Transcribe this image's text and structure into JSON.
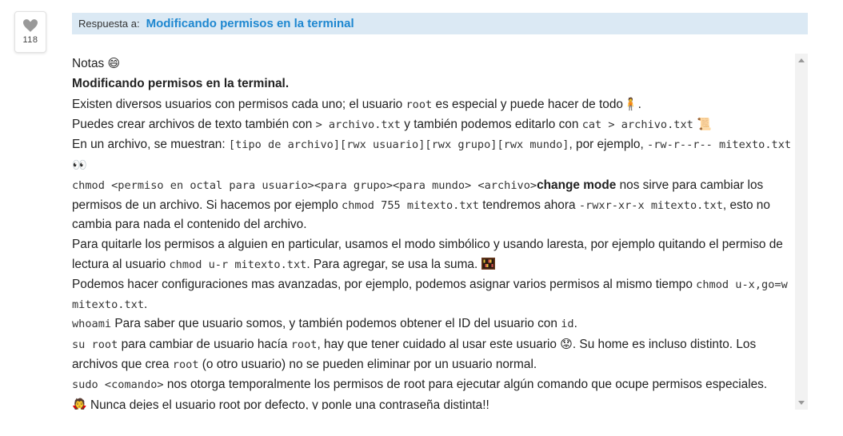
{
  "like": {
    "count": "118",
    "icon": "heart-icon"
  },
  "reply": {
    "prefix": "Respuesta a:",
    "title": "Modificando permisos en la terminal"
  },
  "post": {
    "l1_text": "Notas ",
    "l1_emoji": "😄",
    "l2_bold": "Modificando permisos en la terminal.",
    "l3_a": "Existen diversos usuarios con permisos cada uno; el usuario ",
    "l3_code": "root",
    "l3_b": " es especial y puede hacer de todo",
    "l3_emoji": "🧍",
    "l3_c": ".",
    "l4_a": "Puedes crear archivos de texto también con ",
    "l4_code1": "> archivo.txt",
    "l4_b": " y también podemos editarlo con ",
    "l4_code2": "cat > archivo.txt",
    "l4_emoji": "📜",
    "l5_a": "En un archivo, se muestran: ",
    "l5_code1": "[tipo de archivo][rwx usuario][rwx grupo][rwx mundo]",
    "l5_b": ", por ejemplo, ",
    "l5_code2": "-rw-r--r-- mitexto.txt",
    "l5_emoji": "👀",
    "l6_code": "chmod <permiso en octal para usuario><para grupo><para mundo> <archivo>",
    "l6_bold": "change mode",
    "l6_a": " nos sirve para cambiar los permisos de un archivo. Si hacemos por ejemplo ",
    "l6_code2": "chmod 755 mitexto.txt",
    "l6_b": " tendremos ahora ",
    "l6_code3": "-rwxr-xr-x mitexto.txt",
    "l6_c": ", esto no cambia para nada el contenido del archivo.",
    "l7_a": "Para quitarle los permisos a alguien en particular, usamos el modo simbólico y usando laresta, por ejemplo quitando el permiso de lectura al usuario ",
    "l7_code": "chmod u-r mitexto.txt",
    "l7_b": ". Para agregar, se usa la suma. ",
    "l8_a": "Podemos hacer configuraciones mas avanzadas, por ejemplo, podemos asignar varios permisos al mismo tiempo ",
    "l8_code": "chmod u-x,go=w mitexto.txt",
    "l8_b": ".",
    "l9_code": "whoami",
    "l9_a": " Para saber que usuario somos, y también podemos obtener el ID del usuario con ",
    "l9_code2": "id",
    "l9_b": ".",
    "l10_code": "su root",
    "l10_a": " para cambiar de usuario hacía ",
    "l10_code2": "root",
    "l10_b": ", hay que tener cuidado al usar este usuario ",
    "l10_emoji": "😟",
    "l10_c": ". Su home es incluso distinto. Los archivos que crea ",
    "l10_code3": "root",
    "l10_d": " (o otro usuario) no se pueden eliminar por un usuario normal.",
    "l11_code": "sudo <comando>",
    "l11_a": " nos otorga temporalmente los permisos de root para ejecutar algún comando que ocupe permisos especiales.",
    "l12_emoji": "🧛",
    "l12_a": " Nunca dejes el usuario root por defecto, y ponle una contraseña distinta!!"
  },
  "colors": {
    "accent": "#1e87d0",
    "reply_bg": "#dbe9f4"
  }
}
